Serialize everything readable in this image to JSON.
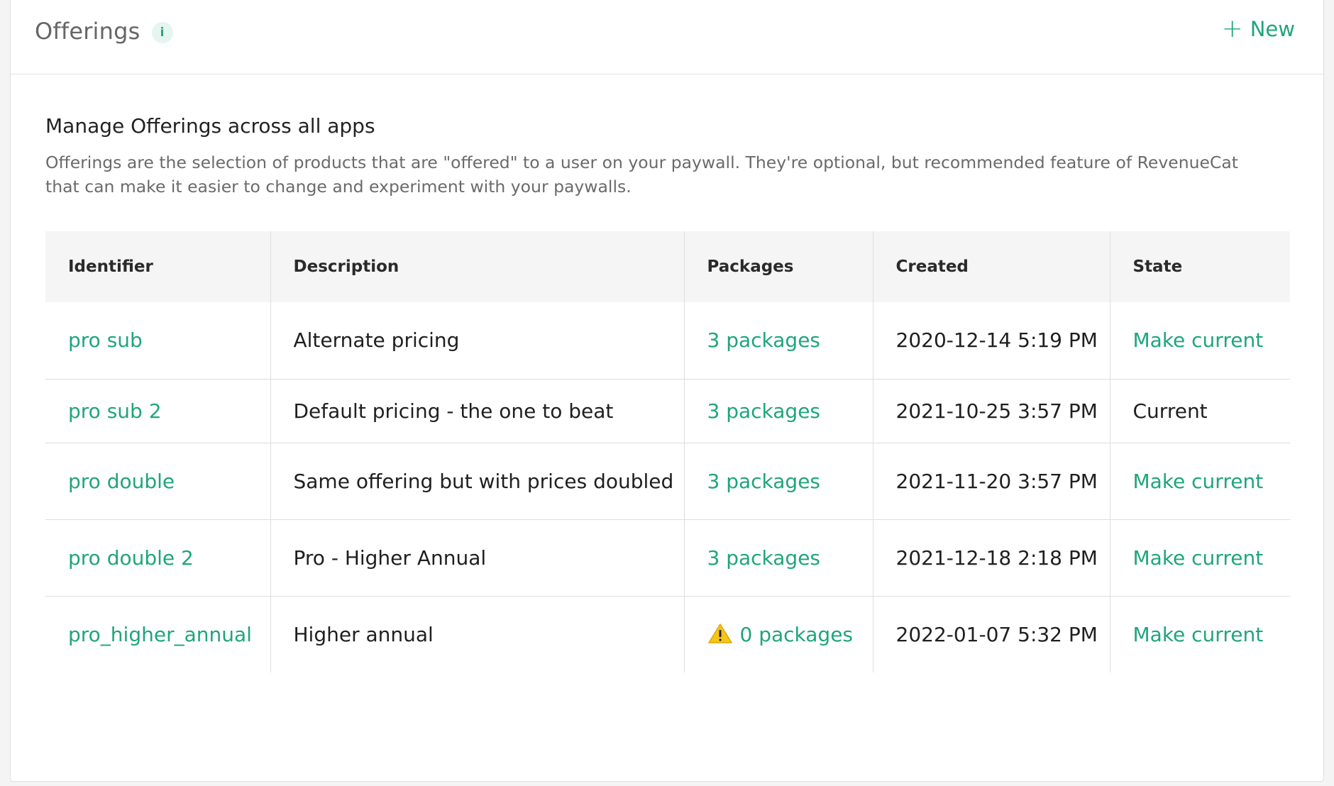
{
  "header": {
    "title": "Offerings",
    "info_icon": "i",
    "new_button_icon": "+",
    "new_button_label": "New"
  },
  "intro": {
    "title": "Manage Offerings across all apps",
    "description": "Offerings are the selection of products that are \"offered\" to a user on your paywall. They're optional, but recommended feature of RevenueCat that can make it easier to change and experiment with your paywalls."
  },
  "table": {
    "columns": [
      "Identifier",
      "Description",
      "Packages",
      "Created",
      "State"
    ],
    "rows": [
      {
        "identifier": "pro sub",
        "description": "Alternate pricing",
        "packages": "3 packages",
        "created": "2020-12-14 5:19 PM",
        "state": "Make current"
      },
      {
        "identifier": "pro sub 2",
        "description": "Default pricing - the one to beat",
        "packages": "3 packages",
        "created": "2021-10-25 3:57 PM",
        "state": "Current"
      },
      {
        "identifier": "pro double",
        "description": "Same offering but with prices doubled",
        "packages": "3 packages",
        "created": "2021-11-20 3:57 PM",
        "state": "Make current"
      },
      {
        "identifier": "pro double 2",
        "description": "Pro - Higher Annual",
        "packages": "3 packages",
        "created": "2021-12-18 2:18 PM",
        "state": "Make current"
      },
      {
        "identifier": "pro_higher_annual",
        "description": "Higher annual",
        "packages": "0 packages",
        "created": "2022-01-07 5:32 PM",
        "state": "Make current"
      }
    ]
  },
  "colors": {
    "accent": "#1fa57b",
    "warning": "#f5c518"
  },
  "icons": {
    "info": "info-icon",
    "new": "plus-icon",
    "warning": "warning-icon"
  }
}
